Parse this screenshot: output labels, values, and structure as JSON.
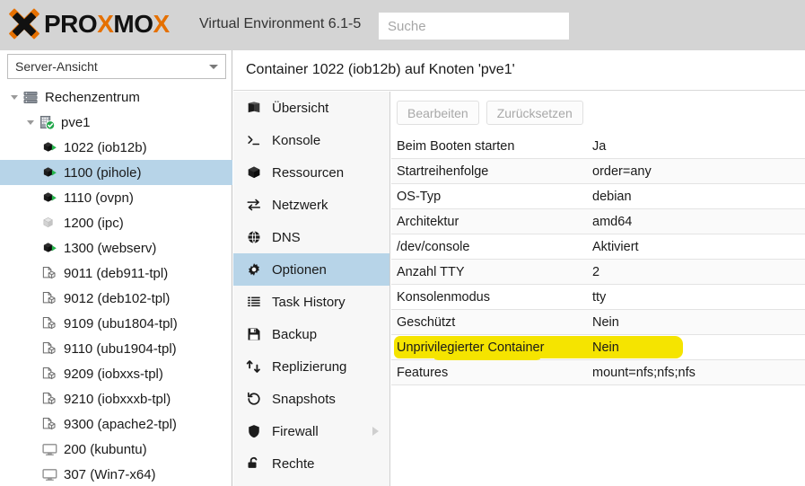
{
  "header": {
    "brand": "PROXMOX",
    "brand_parts": [
      "PRO",
      "X",
      "MO",
      "X"
    ],
    "product": "Virtual Environment 6.1-5",
    "search_placeholder": "Suche",
    "search_value": "",
    "accent_color": "#E57000"
  },
  "sidebar": {
    "view_label": "Server-Ansicht",
    "selected_index": 3,
    "items": [
      {
        "label": "Rechenzentrum",
        "icon": "datacenter-icon",
        "depth": 0,
        "twisty": true
      },
      {
        "label": "pve1",
        "icon": "node-icon",
        "depth": 1,
        "twisty": true
      },
      {
        "label": "1022 (iob12b)",
        "icon": "container-running-icon",
        "depth": 2,
        "twisty": false
      },
      {
        "label": "1100 (pihole)",
        "icon": "container-running-icon",
        "depth": 2,
        "twisty": false
      },
      {
        "label": "1110 (ovpn)",
        "icon": "container-running-icon",
        "depth": 2,
        "twisty": false
      },
      {
        "label": "1200 (ipc)",
        "icon": "container-stopped-icon",
        "depth": 2,
        "twisty": false
      },
      {
        "label": "1300 (webserv)",
        "icon": "container-running-icon",
        "depth": 2,
        "twisty": false
      },
      {
        "label": "9011 (deb911-tpl)",
        "icon": "template-icon",
        "depth": 2,
        "twisty": false
      },
      {
        "label": "9012 (deb102-tpl)",
        "icon": "template-icon",
        "depth": 2,
        "twisty": false
      },
      {
        "label": "9109 (ubu1804-tpl)",
        "icon": "template-icon",
        "depth": 2,
        "twisty": false
      },
      {
        "label": "9110 (ubu1904-tpl)",
        "icon": "template-icon",
        "depth": 2,
        "twisty": false
      },
      {
        "label": "9209 (iobxxs-tpl)",
        "icon": "template-icon",
        "depth": 2,
        "twisty": false
      },
      {
        "label": "9210 (iobxxxb-tpl)",
        "icon": "template-icon",
        "depth": 2,
        "twisty": false
      },
      {
        "label": "9300 (apache2-tpl)",
        "icon": "template-icon",
        "depth": 2,
        "twisty": false
      },
      {
        "label": "200 (kubuntu)",
        "icon": "vm-icon",
        "depth": 2,
        "twisty": false
      },
      {
        "label": "307 (Win7-x64)",
        "icon": "vm-icon",
        "depth": 2,
        "twisty": false
      }
    ],
    "selection_color": "#b7d4e8"
  },
  "main": {
    "title": "Container 1022 (iob12b) auf Knoten 'pve1'",
    "menu_selected_index": 5,
    "menu": [
      {
        "label": "Übersicht",
        "icon": "book-icon",
        "submenu": false
      },
      {
        "label": "Konsole",
        "icon": "terminal-icon",
        "submenu": false
      },
      {
        "label": "Ressourcen",
        "icon": "cube-icon",
        "submenu": false
      },
      {
        "label": "Netzwerk",
        "icon": "exchange-arrows-icon",
        "submenu": false
      },
      {
        "label": "DNS",
        "icon": "globe-icon",
        "submenu": false
      },
      {
        "label": "Optionen",
        "icon": "gear-icon",
        "submenu": false
      },
      {
        "label": "Task History",
        "icon": "list-icon",
        "submenu": false
      },
      {
        "label": "Backup",
        "icon": "floppy-disk-icon",
        "submenu": false
      },
      {
        "label": "Replizierung",
        "icon": "retweet-icon",
        "submenu": false
      },
      {
        "label": "Snapshots",
        "icon": "history-icon",
        "submenu": false
      },
      {
        "label": "Firewall",
        "icon": "shield-icon",
        "submenu": true
      },
      {
        "label": "Rechte",
        "icon": "unlock-icon",
        "submenu": false
      }
    ],
    "toolbar": {
      "edit_label": "Bearbeiten",
      "reset_label": "Zurücksetzen",
      "edit_disabled": true,
      "reset_disabled": true
    },
    "options": [
      {
        "key": "Beim Booten starten",
        "value": "Ja",
        "highlighted": false
      },
      {
        "key": "Startreihenfolge",
        "value": "order=any",
        "highlighted": false
      },
      {
        "key": "OS-Typ",
        "value": "debian",
        "highlighted": false
      },
      {
        "key": "Architektur",
        "value": "amd64",
        "highlighted": false
      },
      {
        "key": "/dev/console",
        "value": "Aktiviert",
        "highlighted": false
      },
      {
        "key": "Anzahl TTY",
        "value": "2",
        "highlighted": false
      },
      {
        "key": "Konsolenmodus",
        "value": "tty",
        "highlighted": false
      },
      {
        "key": "Geschützt",
        "value": "Nein",
        "highlighted": false
      },
      {
        "key": "Unprivilegierter Container",
        "value": "Nein",
        "highlighted": true
      },
      {
        "key": "Features",
        "value": "mount=nfs;nfs;nfs",
        "highlighted": false
      }
    ],
    "highlight_color": "#f5e400"
  }
}
